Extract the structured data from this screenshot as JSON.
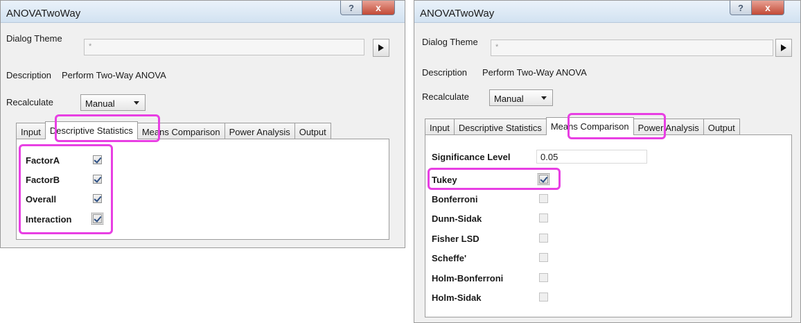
{
  "accent_color": "#e83fe3",
  "dialog_left": {
    "title": "ANOVATwoWay",
    "help_label": "?",
    "close_label": "x",
    "theme_label": "Dialog Theme",
    "theme_value": "*",
    "description_label": "Description",
    "description_value": "Perform Two-Way ANOVA",
    "recalculate_label": "Recalculate",
    "recalculate_value": "Manual",
    "tabs": [
      "Input",
      "Descriptive Statistics",
      "Means Comparison",
      "Power Analysis",
      "Output"
    ],
    "active_tab": "Descriptive Statistics",
    "options": [
      {
        "label": "FactorA",
        "checked": true
      },
      {
        "label": "FactorB",
        "checked": true
      },
      {
        "label": "Overall",
        "checked": true
      },
      {
        "label": "Interaction",
        "checked": true
      }
    ]
  },
  "dialog_right": {
    "title": "ANOVATwoWay",
    "help_label": "?",
    "close_label": "x",
    "theme_label": "Dialog Theme",
    "theme_value": "*",
    "description_label": "Description",
    "description_value": "Perform Two-Way ANOVA",
    "recalculate_label": "Recalculate",
    "recalculate_value": "Manual",
    "tabs": [
      "Input",
      "Descriptive Statistics",
      "Means Comparison",
      "Power Analysis",
      "Output"
    ],
    "active_tab": "Means Comparison",
    "significance_label": "Significance Level",
    "significance_value": "0.05",
    "methods": [
      {
        "label": "Tukey",
        "checked": true
      },
      {
        "label": "Bonferroni",
        "checked": false
      },
      {
        "label": "Dunn-Sidak",
        "checked": false
      },
      {
        "label": "Fisher LSD",
        "checked": false
      },
      {
        "label": "Scheffe'",
        "checked": false
      },
      {
        "label": "Holm-Bonferroni",
        "checked": false
      },
      {
        "label": "Holm-Sidak",
        "checked": false
      }
    ]
  }
}
